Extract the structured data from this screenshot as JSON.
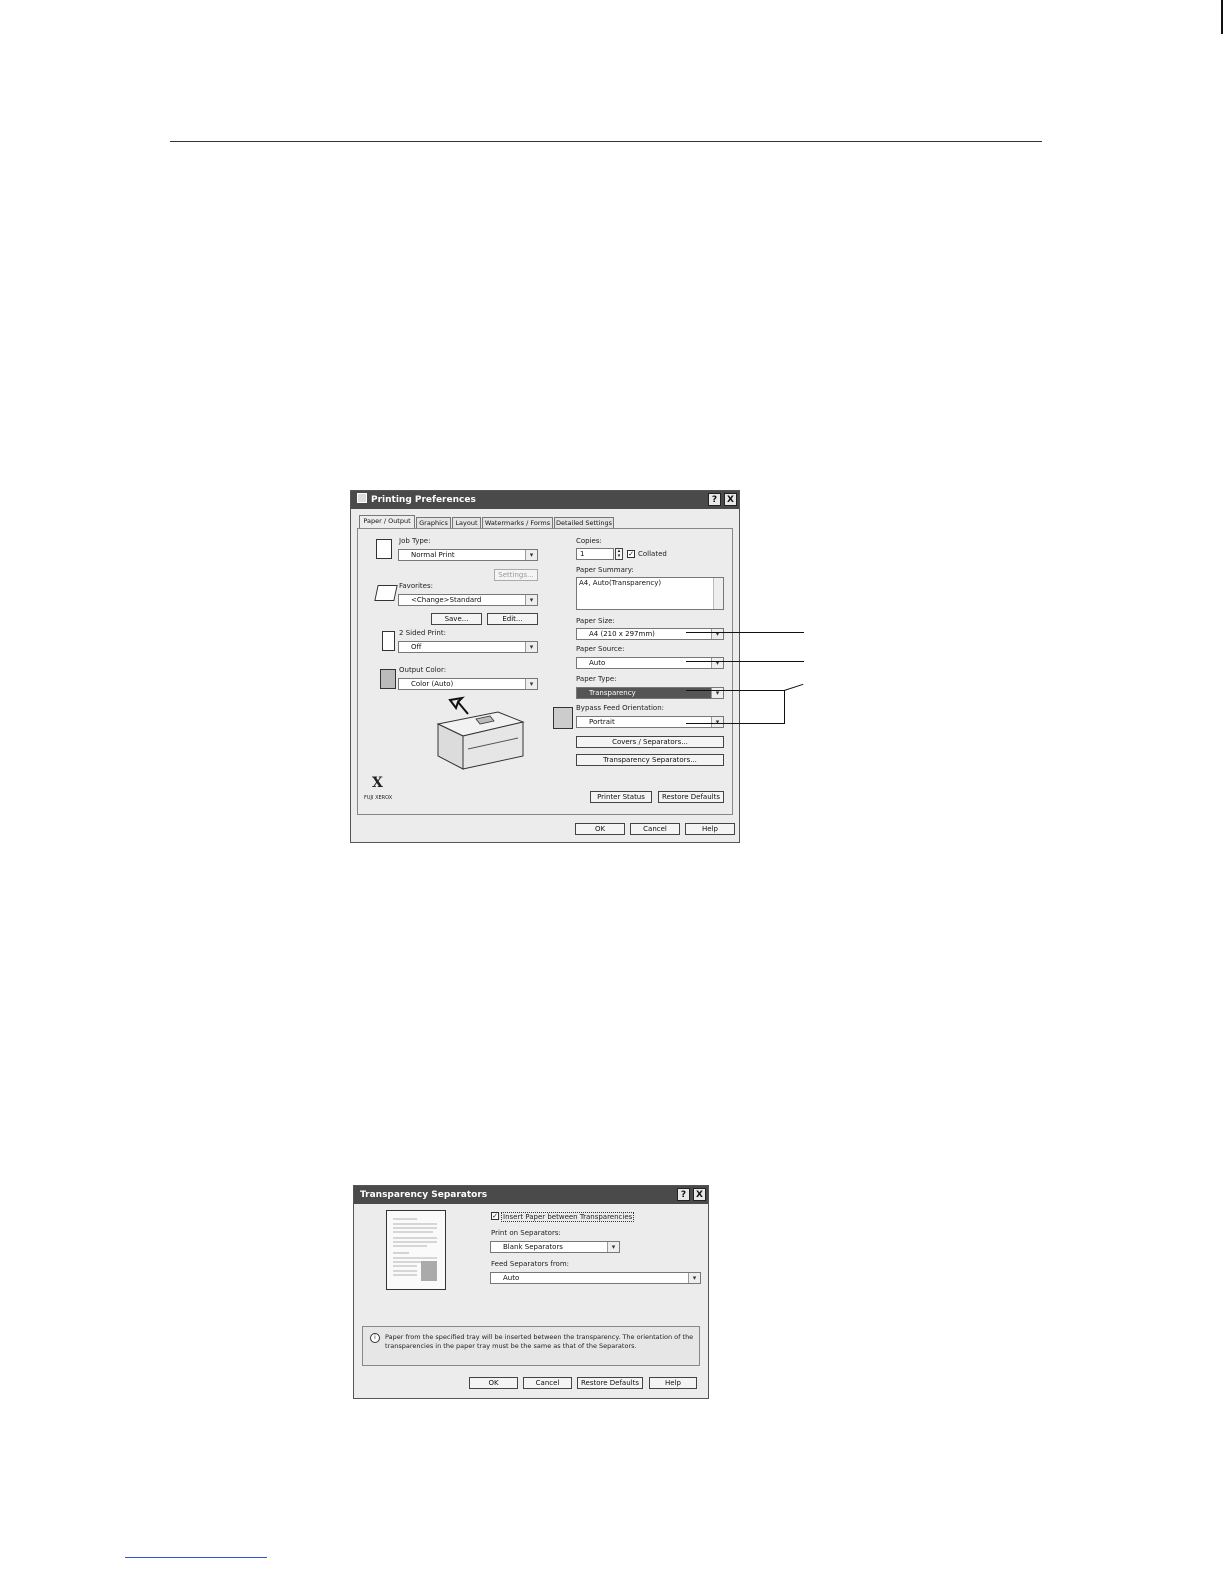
{
  "printing_preferences": {
    "title": "Printing Preferences",
    "help_btn": "?",
    "close_btn": "X",
    "tabs": [
      "Paper / Output",
      "Graphics",
      "Layout",
      "Watermarks / Forms",
      "Detailed Settings"
    ],
    "job_type": {
      "label": "Job Type:",
      "value": "Normal Print"
    },
    "settings_button": "Settings...",
    "favorites": {
      "label": "Favorites:",
      "value": "<Change>Standard"
    },
    "save_button": "Save...",
    "edit_button": "Edit...",
    "two_sided": {
      "label": "2 Sided Print:",
      "value": "Off"
    },
    "output_color": {
      "label": "Output Color:",
      "value": "Color (Auto)"
    },
    "copies": {
      "label": "Copies:",
      "value": "1",
      "collated_label": "Collated",
      "collated_mark": "✓"
    },
    "paper_summary": {
      "label": "Paper Summary:",
      "value": "A4, Auto(Transparency)"
    },
    "paper_size": {
      "label": "Paper Size:",
      "value": "A4 (210 x 297mm)"
    },
    "paper_source": {
      "label": "Paper Source:",
      "value": "Auto"
    },
    "paper_type": {
      "label": "Paper Type:",
      "value": "Transparency"
    },
    "bypass_feed": {
      "label": "Bypass Feed Orientation:",
      "value": "Portrait"
    },
    "covers_button": "Covers / Separators...",
    "transparency_button": "Transparency Separators...",
    "printer_status_button": "Printer Status",
    "restore_defaults_button": "Restore Defaults",
    "brand_mark": "X",
    "brand_name": "FUJI XEROX",
    "ok_button": "OK",
    "cancel_button": "Cancel",
    "help_button": "Help"
  },
  "transparency_separators": {
    "title": "Transparency Separators",
    "help_btn": "?",
    "close_btn": "X",
    "insert_label": "Insert Paper between Transparencies",
    "insert_mark": "✓",
    "print_on": {
      "label": "Print on Separators:",
      "value": "Blank Separators"
    },
    "feed_from": {
      "label": "Feed Separators from:",
      "value": "Auto"
    },
    "info_icon": "i",
    "info_text_1": "Paper from the specified tray will be inserted between the transparency. The orientation of the",
    "info_text_2": "transparencies in the paper tray must be the same as that of the Separators.",
    "ok_button": "OK",
    "cancel_button": "Cancel",
    "restore_defaults_button": "Restore Defaults",
    "help_button": "Help"
  }
}
